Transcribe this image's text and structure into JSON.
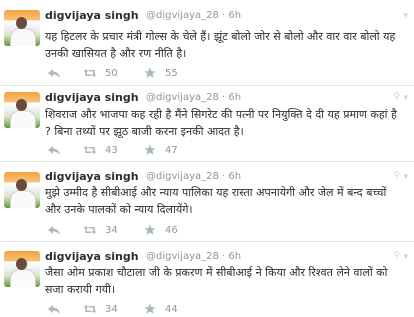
{
  "tweets": [
    {
      "name": "digvijaya singh",
      "handle": "@digvijaya_28",
      "sep": "·",
      "time": "6h",
      "text": "यह हिटलर के प्रचार मंत्री गोल्स के चेले हैं। झूंट बोलो जोर से बोलो और वार वार बोलो यह उनकी खासियत है और रण नीति है।",
      "retweets": "50",
      "favorites": "55"
    },
    {
      "name": "digvijaya singh",
      "handle": "@digvijaya_28",
      "sep": "·",
      "time": "6h",
      "text": "शिवराज और भाजपा कह रही है मैंने सिगरेट की पत्नी पर नियुक्ति दे दी यह प्रमाण कहां है ? बिना तथ्यों पर झूठ बाजी करना इनकी आदत है।",
      "retweets": "43",
      "favorites": "47"
    },
    {
      "name": "digvijaya singh",
      "handle": "@digvijaya_28",
      "sep": "·",
      "time": "6h",
      "text": "मुझे उम्मीद है सीबीआई और न्याय पालिका यह रास्ता अपनायेगी और जेल में बन्द बच्चों और उनके पालकों को न्याय दिलायेंगे।",
      "retweets": "34",
      "favorites": "46"
    },
    {
      "name": "digvijaya singh",
      "handle": "@digvijaya_28",
      "sep": "·",
      "time": "6h",
      "text": "जैसा ओम प्रकाश चौटाला जी के प्रकरण में सीबीआई ने किया और रिश्वत लेने वालों को सजा करायी गयी।",
      "retweets": "34",
      "favorites": "44"
    }
  ],
  "icons": {
    "reply": "reply-icon",
    "retweet": "retweet-icon",
    "favorite": "star-icon",
    "more": "chevron-down-icon",
    "location": "location-pin-icon"
  },
  "colors": {
    "text": "#292f33",
    "muted": "#8899a6",
    "divider": "#e1e8ed"
  }
}
